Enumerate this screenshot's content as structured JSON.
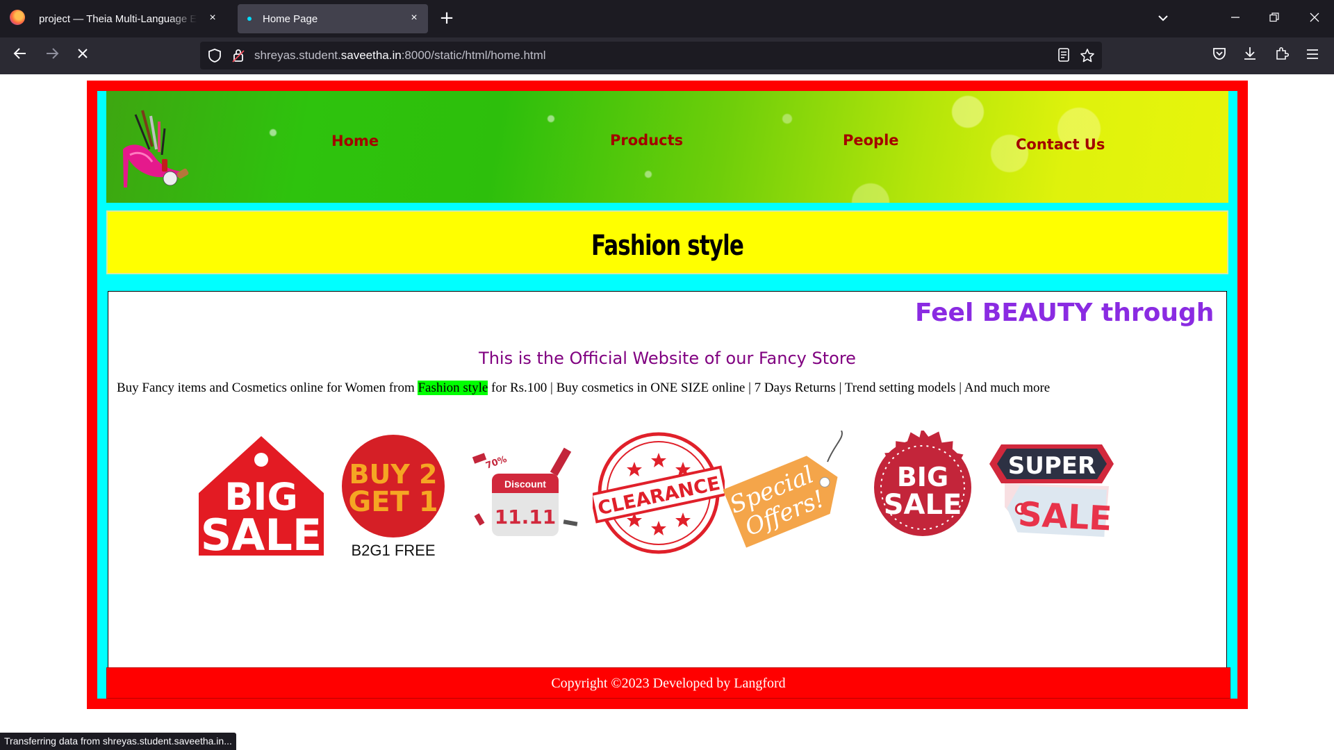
{
  "browser": {
    "tabs": [
      {
        "title": "project — Theia Multi-Language Ex",
        "close": "×"
      },
      {
        "title": "Home Page",
        "close": "×"
      }
    ],
    "new_tab": "+",
    "url_host_prefix": "shreyas.student.",
    "url_host": "saveetha.in",
    "url_rest": ":8000/static/html/home.html",
    "status": "Transferring data from shreyas.student.saveetha.in..."
  },
  "header": {
    "nav": [
      "Home",
      "Products",
      "People",
      "Contact Us"
    ]
  },
  "banner": {
    "title": "Fashion style"
  },
  "content": {
    "marquee": "Feel BEAUTY through c",
    "subtitle": "This is the Official Website of our Fancy Store",
    "desc_before": "Buy Fancy items and Cosmetics online for Women from ",
    "desc_highlight": "Fashion style",
    "desc_after": " for Rs.100 | Buy cosmetics in ONE SIZE online | 7 Days Returns | Trend setting models | And much more",
    "badges": {
      "big_sale": [
        "BIG",
        "SALE"
      ],
      "buy2get1": [
        "BUY 2",
        "GET 1",
        "B2G1 FREE"
      ],
      "discount": [
        "Discount",
        "11.11",
        "70%"
      ],
      "clearance": "CLEARANCE",
      "special": [
        "Special",
        "Offers!"
      ],
      "big_sale_seal": [
        "BIG",
        "SALE"
      ],
      "super_sale": [
        "SUPER",
        "SALE"
      ]
    }
  },
  "footer": {
    "text": "Copyright ©2023 Developed by Langford"
  },
  "colors": {
    "frame": "#ff0000",
    "inner": "#00ffff",
    "banner": "#ffff00",
    "nav_text": "#a30000",
    "marquee": "#8a2be2",
    "subtitle": "#800080",
    "highlight": "#00ff00"
  }
}
